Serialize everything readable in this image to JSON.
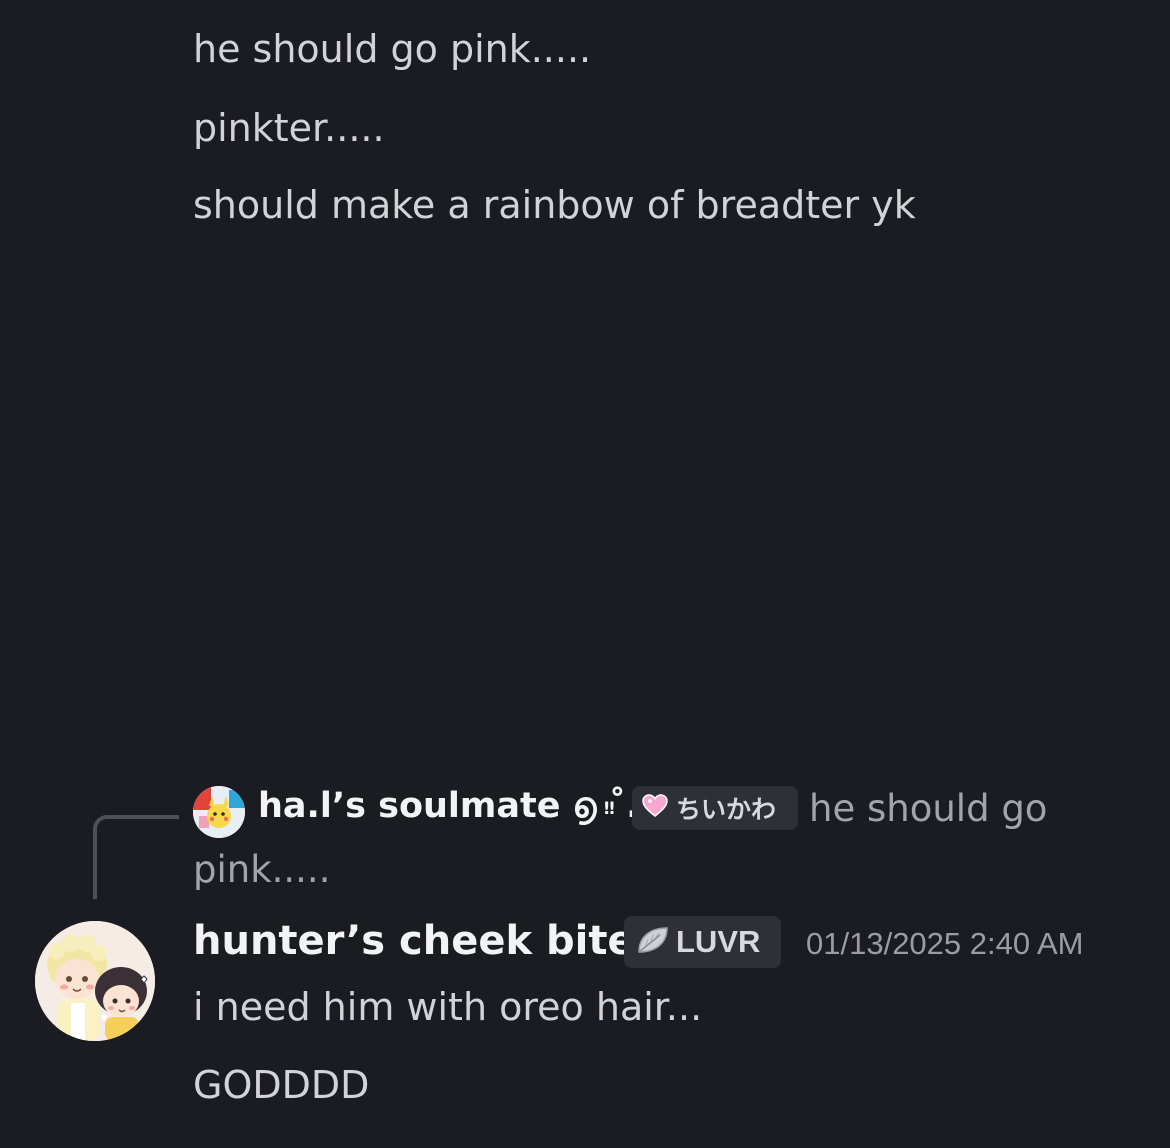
{
  "previous_messages": [
    "he should go pink.....",
    "pinkter.....",
    "should make a rainbow of breadter yk"
  ],
  "reply": {
    "author": "ha.l’s soulmate ൭ ˚.",
    "author_suffix": "‼",
    "tag_icon": "pink-heart-icon",
    "tag_label": "ちいかわ",
    "text_line1": "he should go",
    "text_line2": "pink....."
  },
  "message": {
    "author": "hunter’s cheek biter",
    "tag_icon": "leaf-icon",
    "tag_label": "LUVR",
    "timestamp": "01/13/2025 2:40 AM",
    "lines": [
      "i need him with oreo hair...",
      "GODDDD"
    ]
  },
  "colors": {
    "background": "#1b1c21",
    "username": "#f2f3f5",
    "message_text": "#d2d3d8",
    "muted_text": "#a2a4ab",
    "tag_background": "#2f3037"
  }
}
